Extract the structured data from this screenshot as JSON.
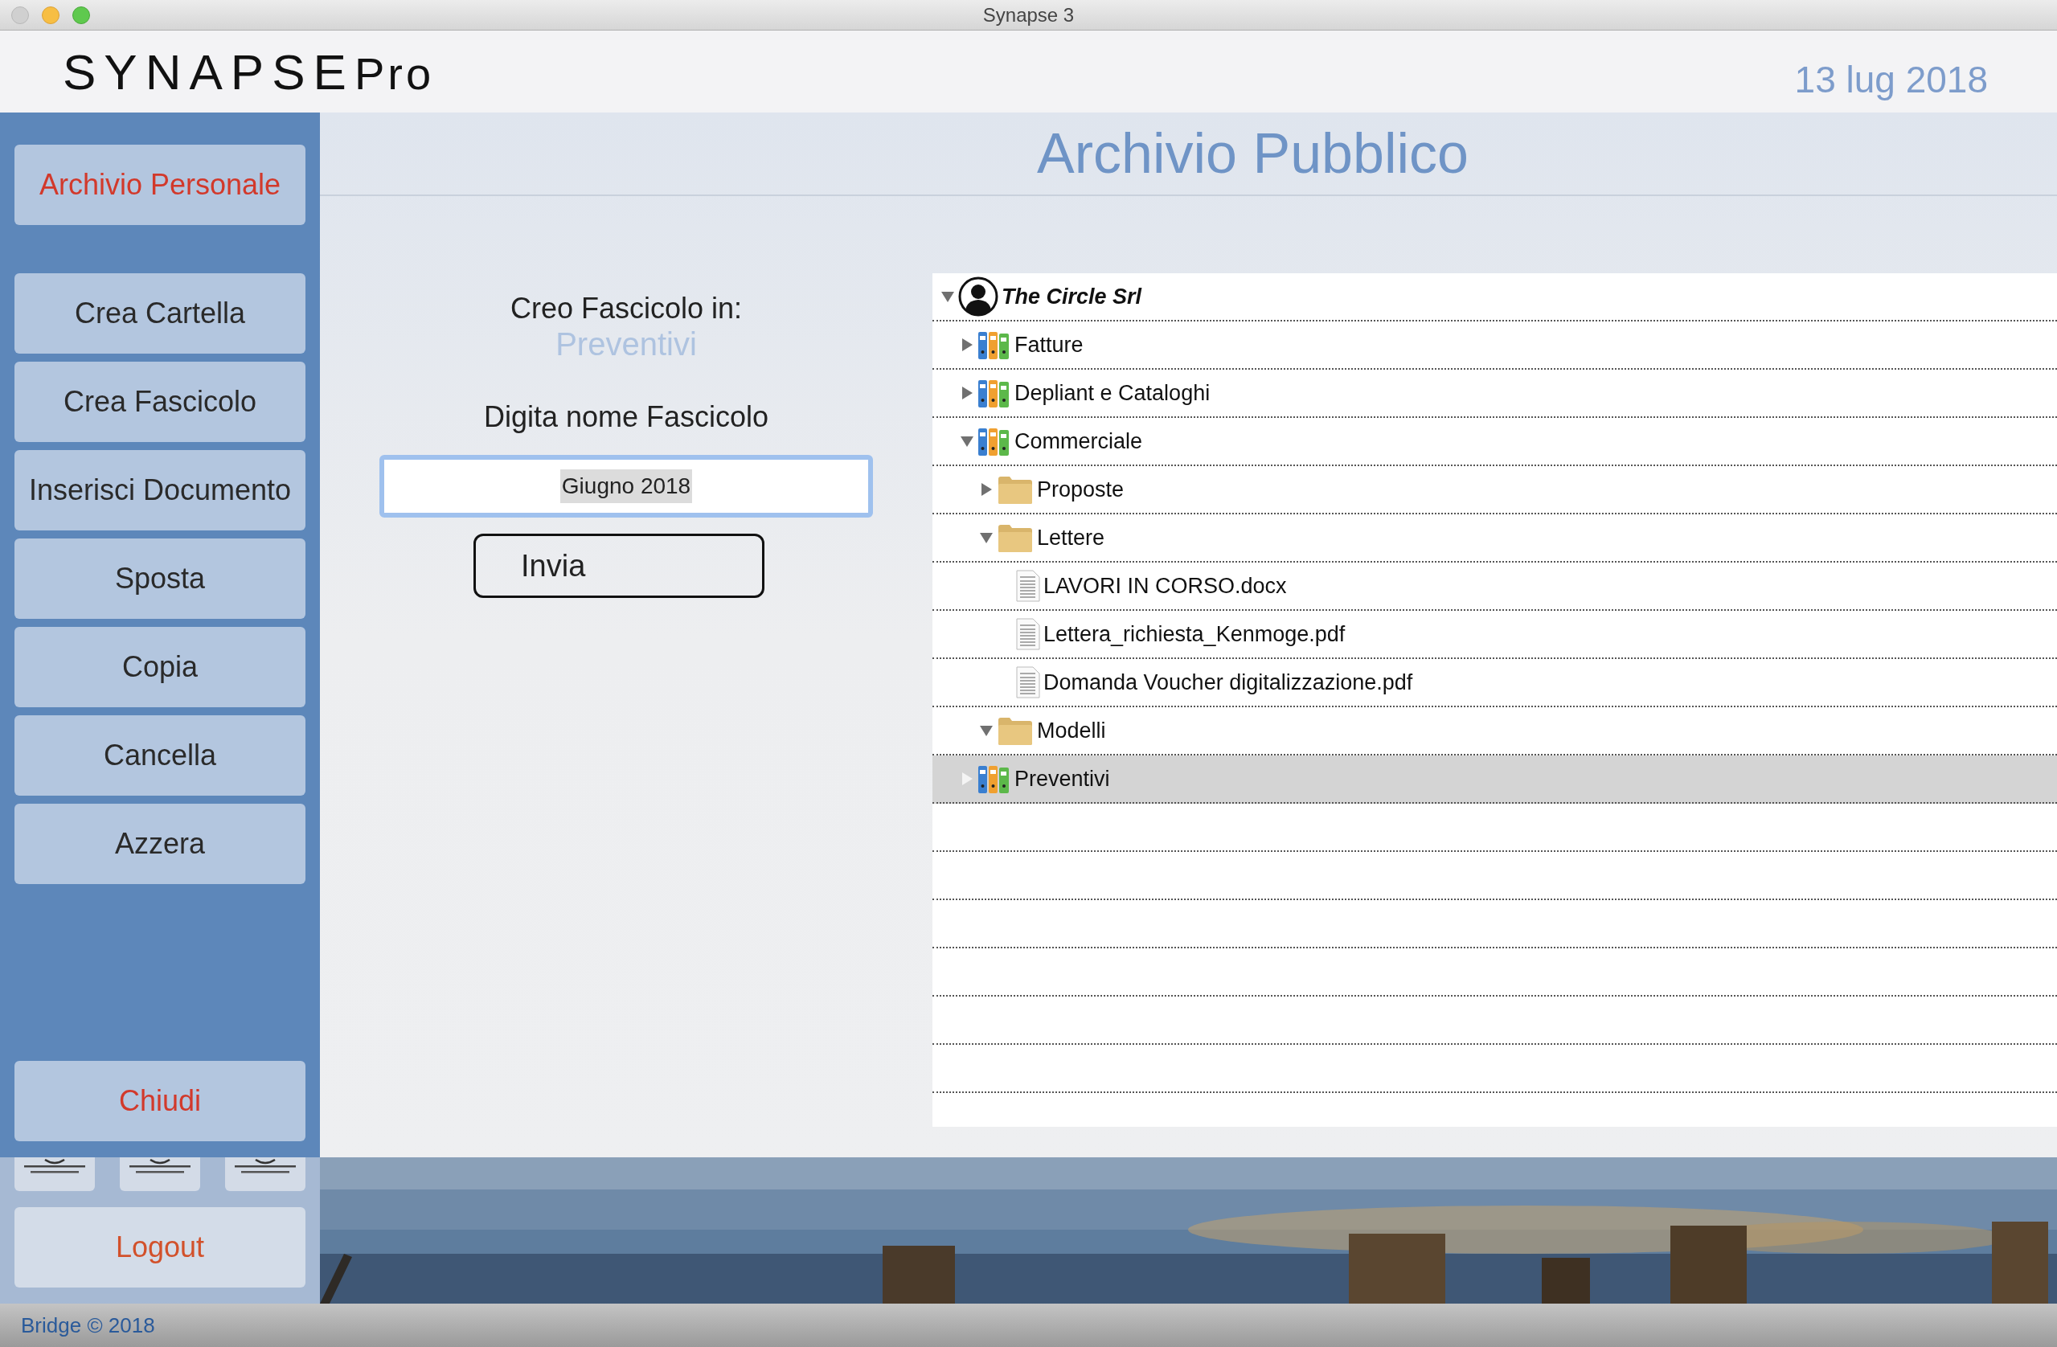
{
  "window": {
    "title": "Synapse 3"
  },
  "header": {
    "logo_main": "SYNAPSE",
    "logo_suffix": "Pro",
    "date": "13 lug 2018"
  },
  "sidebar": {
    "items": [
      {
        "label": "Archivio Personale",
        "kind": "accent"
      },
      {
        "label": "Crea Cartella",
        "kind": "normal"
      },
      {
        "label": "Crea Fascicolo",
        "kind": "normal"
      },
      {
        "label": "Inserisci Documento",
        "kind": "normal"
      },
      {
        "label": "Sposta",
        "kind": "normal"
      },
      {
        "label": "Copia",
        "kind": "normal"
      },
      {
        "label": "Cancella",
        "kind": "normal"
      },
      {
        "label": "Azzera",
        "kind": "normal"
      }
    ],
    "close_button": "Chiudi",
    "logout_button": "Logout"
  },
  "main": {
    "title": "Archivio Pubblico",
    "form": {
      "target_label": "Creo Fascicolo in:",
      "target_value": "Preventivi",
      "name_label": "Digita nome Fascicolo",
      "name_value": "Giugno 2018",
      "submit": "Invia"
    },
    "tree": [
      {
        "label": "The Circle Srl",
        "kind": "company",
        "expanded": true,
        "selected": false,
        "children": [
          {
            "label": "Fatture",
            "kind": "binder",
            "expanded": false,
            "selected": false
          },
          {
            "label": "Depliant e Cataloghi",
            "kind": "binder",
            "expanded": false,
            "selected": false
          },
          {
            "label": "Commerciale",
            "kind": "binder",
            "expanded": true,
            "selected": false,
            "children": [
              {
                "label": "Proposte",
                "kind": "folder",
                "expanded": false,
                "selected": false
              },
              {
                "label": "Lettere",
                "kind": "folder",
                "expanded": true,
                "selected": false,
                "children": [
                  {
                    "label": "LAVORI IN CORSO.docx",
                    "kind": "document",
                    "selected": false
                  },
                  {
                    "label": "Lettera_richiesta_Kenmoge.pdf",
                    "kind": "document",
                    "selected": false
                  },
                  {
                    "label": "Domanda Voucher digitalizzazione.pdf",
                    "kind": "document",
                    "selected": false
                  }
                ]
              },
              {
                "label": "Modelli",
                "kind": "folder",
                "expanded": true,
                "selected": false
              }
            ]
          },
          {
            "label": "Preventivi",
            "kind": "binder",
            "expanded": false,
            "selected": true
          }
        ]
      }
    ]
  },
  "status_bar": "Bridge © 2018"
}
